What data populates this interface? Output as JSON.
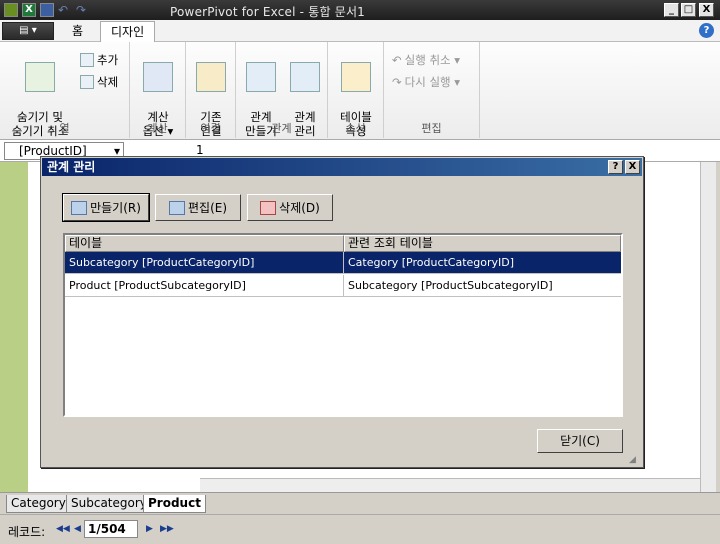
{
  "window": {
    "title": "PowerPivot for Excel - 통합 문서1",
    "min": "_",
    "max": "□",
    "close": "X"
  },
  "tabs": {
    "file": "▤ ▾",
    "home": "홈",
    "design": "디자인"
  },
  "ribbon": {
    "groups": {
      "columns": {
        "label": "열",
        "hide_unhide": "숨기기 및\n숨기기 취소",
        "add": "추가",
        "delete": "삭제"
      },
      "calc": {
        "label": "계산",
        "options": "계산\n옵션 ▾"
      },
      "connections": {
        "label": "연결",
        "existing": "기존\n연결"
      },
      "relationships": {
        "label": "관계",
        "create": "관계\n만들기",
        "manage": "관계\n관리"
      },
      "properties": {
        "label": "속성",
        "table_props": "테이블\n속성"
      },
      "edit": {
        "label": "편집",
        "undo": "실행 취소 ▾",
        "redo": "다시 실행 ▾"
      }
    }
  },
  "formula": {
    "namebox": "[ProductID]",
    "namebox_arrow": "▾",
    "value": "1"
  },
  "sheet_tabs": [
    "Category",
    "Subcategory",
    "Product"
  ],
  "status": {
    "record_label": "레코드:",
    "record_value": "1/504",
    "first": "◀◀",
    "prev": "◀",
    "next": "▶",
    "last": "▶▶"
  },
  "dialog": {
    "title": "관계 관리",
    "help": "?",
    "close": "X",
    "buttons": {
      "create": "만들기(R)",
      "edit": "편집(E)",
      "delete": "삭제(D)"
    },
    "columns": [
      "테이블",
      "관련 조회 테이블"
    ],
    "rows": [
      [
        "Subcategory [ProductCategoryID]",
        "Category [ProductCategoryID]"
      ],
      [
        "Product [ProductSubcategoryID]",
        "Subcategory [ProductSubcategoryID]"
      ]
    ],
    "close_button": "닫기(C)",
    "grip": "◢"
  },
  "colors": {
    "selection": "#0a246a",
    "row_header": "#b9cf86"
  }
}
